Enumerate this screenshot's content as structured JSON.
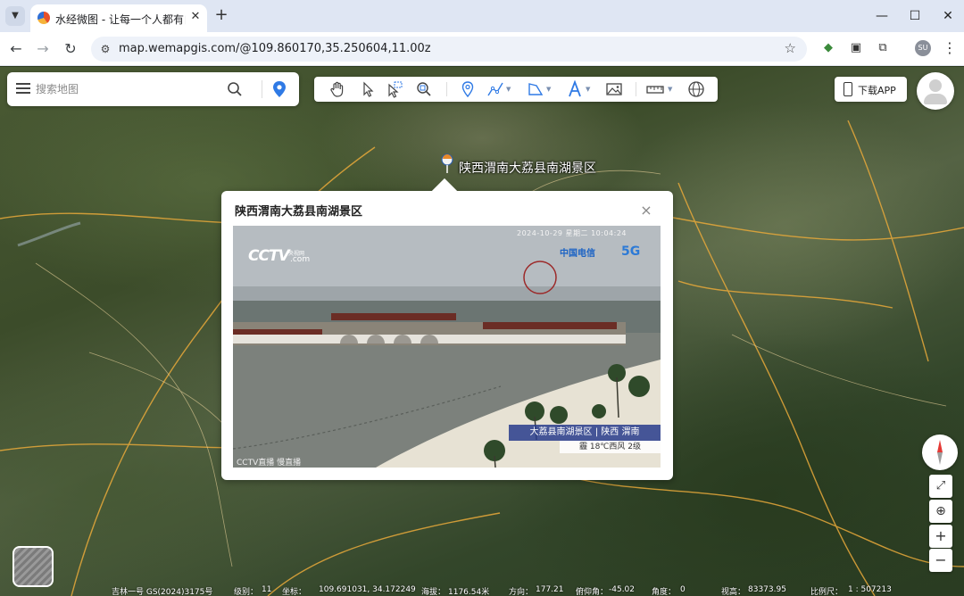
{
  "browser": {
    "tab_title": "水经微图 - 让每一个人都有自己",
    "new_tab_icon": "plus-icon",
    "url": "map.wemapgis.com/@109.860170,35.250604,11.00z",
    "profile_initials": "SU"
  },
  "search": {
    "placeholder": "搜索地图"
  },
  "toolbar": {
    "tools": [
      "hand-pan-icon",
      "pointer-icon",
      "select-area-icon",
      "zoom-search-icon",
      "marker-icon",
      "polyline-icon",
      "polygon-icon",
      "text-icon",
      "image-icon",
      "measure-ruler-icon",
      "globe-icon"
    ]
  },
  "header": {
    "download_label": "下载APP"
  },
  "place": {
    "label": "陕西渭南大荔县南湖景区"
  },
  "popup": {
    "title": "陕西渭南大荔县南湖景区",
    "video": {
      "timestamp": "2024-10-29 星期二 10:04:24",
      "broadcaster": "CCTV",
      "broadcaster_cn": "央视网",
      "broadcaster_domain": ".com",
      "sponsor": "中国电信",
      "sponsor_badge": "5G",
      "caption": "大荔县南湖景区 | 陕西 渭南",
      "weather": "霾 18℃西风 2级",
      "watermark": "CCTV直播 慢直播"
    }
  },
  "status": {
    "satellite": "吉林一号 GS(2024)3175号",
    "level_label": "级别：",
    "level": "11",
    "coord_label": "坐标：",
    "coord": "109.691031, 34.172249",
    "elevation_label": "海拔：",
    "elevation": "1176.54米",
    "heading_label": "方向：",
    "heading": "177.21",
    "pitch_label": "俯仰角：",
    "pitch": "-45.02",
    "roll_label": "角度：",
    "roll": "0",
    "altitude_label": "视高：",
    "altitude": "83373.95",
    "scale_label": "比例尺：",
    "scale": "1 : 507213"
  },
  "colors": {
    "accent_blue": "#2f7ae5",
    "road_orange": "#e8a93a",
    "compass_red": "#e53935"
  }
}
